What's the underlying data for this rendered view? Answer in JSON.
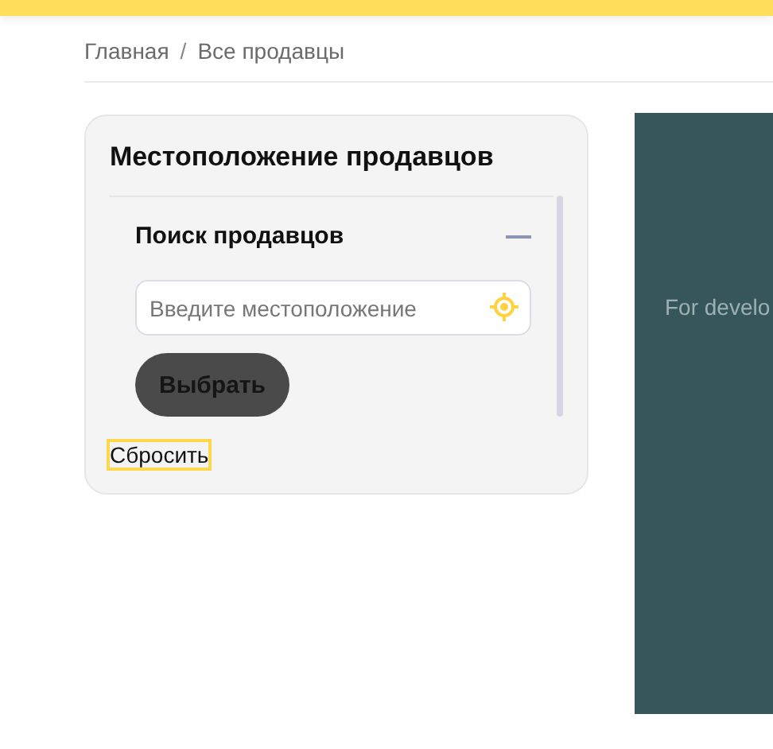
{
  "breadcrumbs": [
    {
      "label": "Главная"
    },
    {
      "label": "Все продавцы"
    }
  ],
  "breadcrumb_separator": "/",
  "filter_card": {
    "title": "Местоположение продавцов",
    "section": {
      "title": "Поиск продавцов",
      "expanded": true,
      "location_field": {
        "placeholder": "Введите местоположение"
      },
      "select_button": "Выбрать"
    },
    "reset_link": {
      "label": "Сбросить",
      "focused": true
    }
  },
  "map": {
    "kind": "picture",
    "notice": "For develo"
  }
}
